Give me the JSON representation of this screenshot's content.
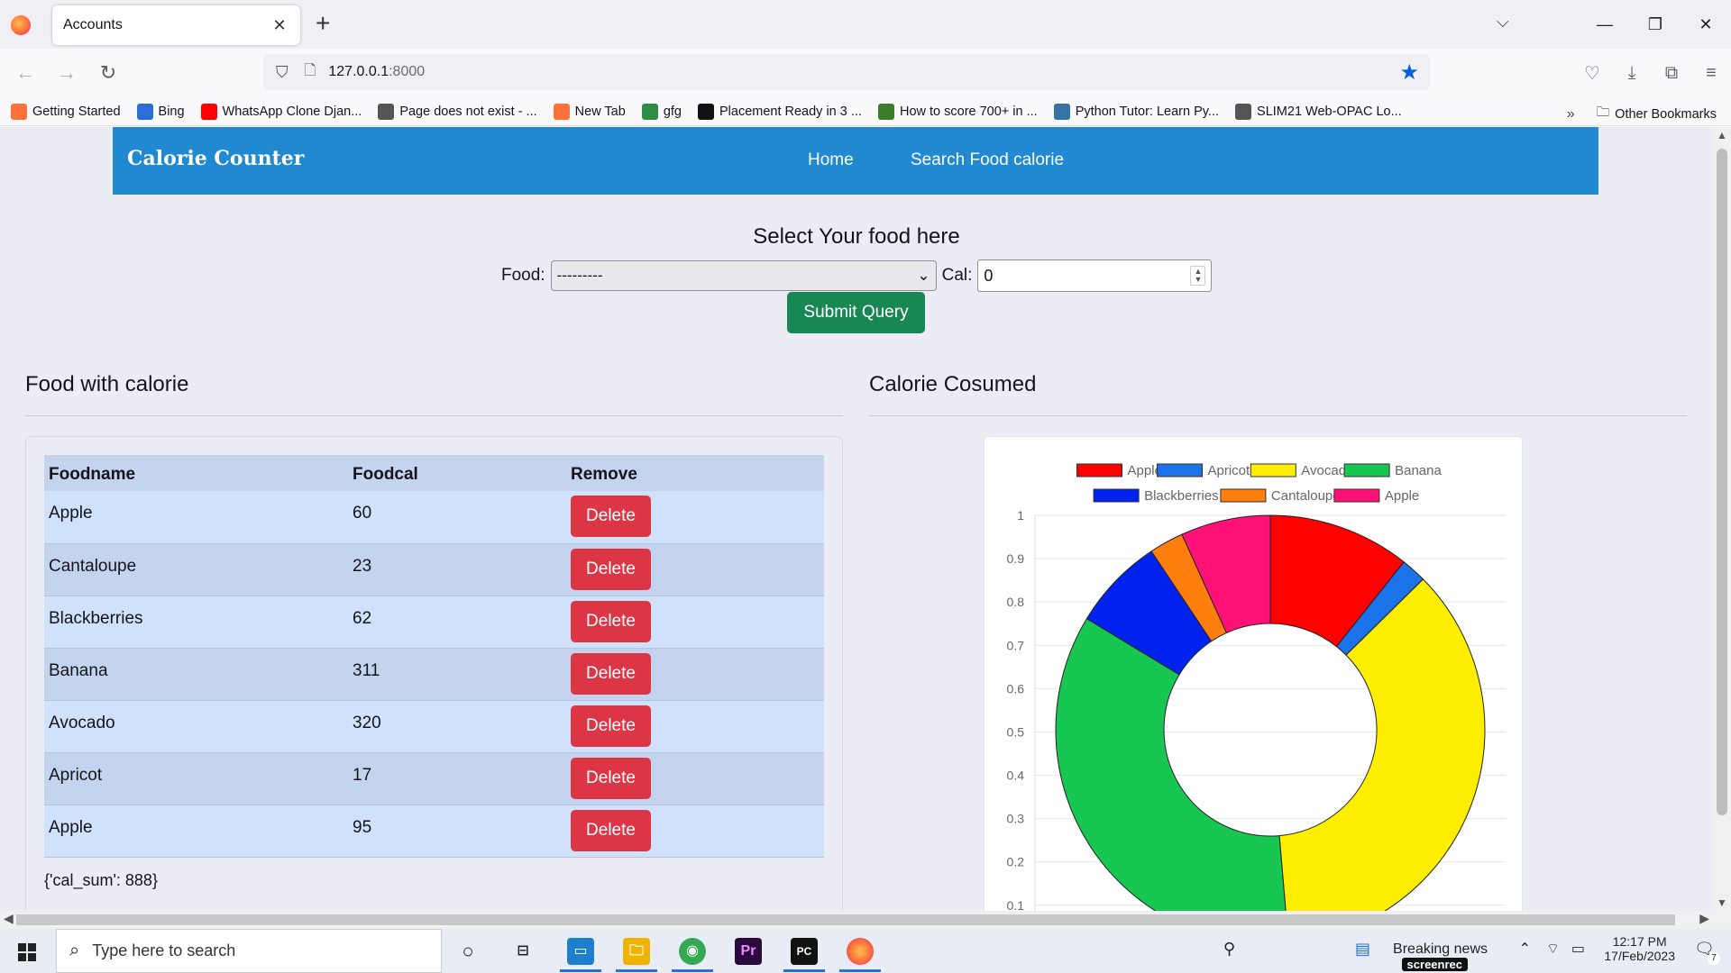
{
  "browser": {
    "tab_title": "Accounts",
    "tab_close": "✕",
    "new_tab": "+",
    "url_host": "127.0.0.1",
    "url_port": ":8000",
    "bookmarks": [
      {
        "label": "Getting Started",
        "color": "#ff7139"
      },
      {
        "label": "Bing",
        "color": "#2b6fd6"
      },
      {
        "label": "WhatsApp Clone Djan...",
        "color": "#ff0000"
      },
      {
        "label": "Page does not exist - ...",
        "color": "#555555"
      },
      {
        "label": "New Tab",
        "color": "#ff7139"
      },
      {
        "label": "gfg",
        "color": "#2f8d46"
      },
      {
        "label": "Placement Ready in 3 ...",
        "color": "#111111"
      },
      {
        "label": "How to score 700+ in ...",
        "color": "#3a7d2a"
      },
      {
        "label": "Python Tutor: Learn Py...",
        "color": "#3572a5"
      },
      {
        "label": "SLIM21 Web-OPAC Lo...",
        "color": "#555555"
      }
    ],
    "other_bookmarks": "Other Bookmarks"
  },
  "app": {
    "brand": "Calorie Counter",
    "nav": [
      "Home",
      "Search Food calorie"
    ],
    "form_title": "Select Your food here",
    "food_label": "Food:",
    "food_selected": "---------",
    "cal_label": "Cal:",
    "cal_value": "0",
    "submit_label": "Submit Query",
    "left_title": "Food with calorie",
    "right_title": "Calorie Cosumed",
    "table": {
      "headers": [
        "Foodname",
        "Foodcal",
        "Remove"
      ],
      "delete_label": "Delete",
      "rows": [
        {
          "name": "Apple",
          "cal": "60"
        },
        {
          "name": "Cantaloupe",
          "cal": "23"
        },
        {
          "name": "Blackberries",
          "cal": "62"
        },
        {
          "name": "Banana",
          "cal": "311"
        },
        {
          "name": "Avocado",
          "cal": "320"
        },
        {
          "name": "Apricot",
          "cal": "17"
        },
        {
          "name": "Apple",
          "cal": "95"
        }
      ]
    },
    "cal_sum": "{'cal_sum': 888}"
  },
  "chart_data": {
    "type": "pie",
    "variant": "doughnut",
    "categories": [
      "Apple",
      "Apricot",
      "Avocado",
      "Banana",
      "Blackberries",
      "Cantaloupe",
      "Apple"
    ],
    "values": [
      95,
      17,
      320,
      311,
      62,
      23,
      60
    ],
    "colors": [
      "#ff0000",
      "#1a73e8",
      "#ffee00",
      "#17c752",
      "#0022ee",
      "#ff7f0e",
      "#ff1177"
    ],
    "y_ticks": [
      "1",
      "0.9",
      "0.8",
      "0.7",
      "0.6",
      "0.5",
      "0.4",
      "0.3",
      "0.2",
      "0.1"
    ],
    "ylim": [
      0,
      1
    ],
    "grid": true,
    "legend": "top"
  },
  "taskbar": {
    "search_placeholder": "Type here to search",
    "news": "Breaking news",
    "time": "12:17 PM",
    "date": "17/Feb/2023",
    "notif_count": "7",
    "screenrec": "screenrec"
  }
}
